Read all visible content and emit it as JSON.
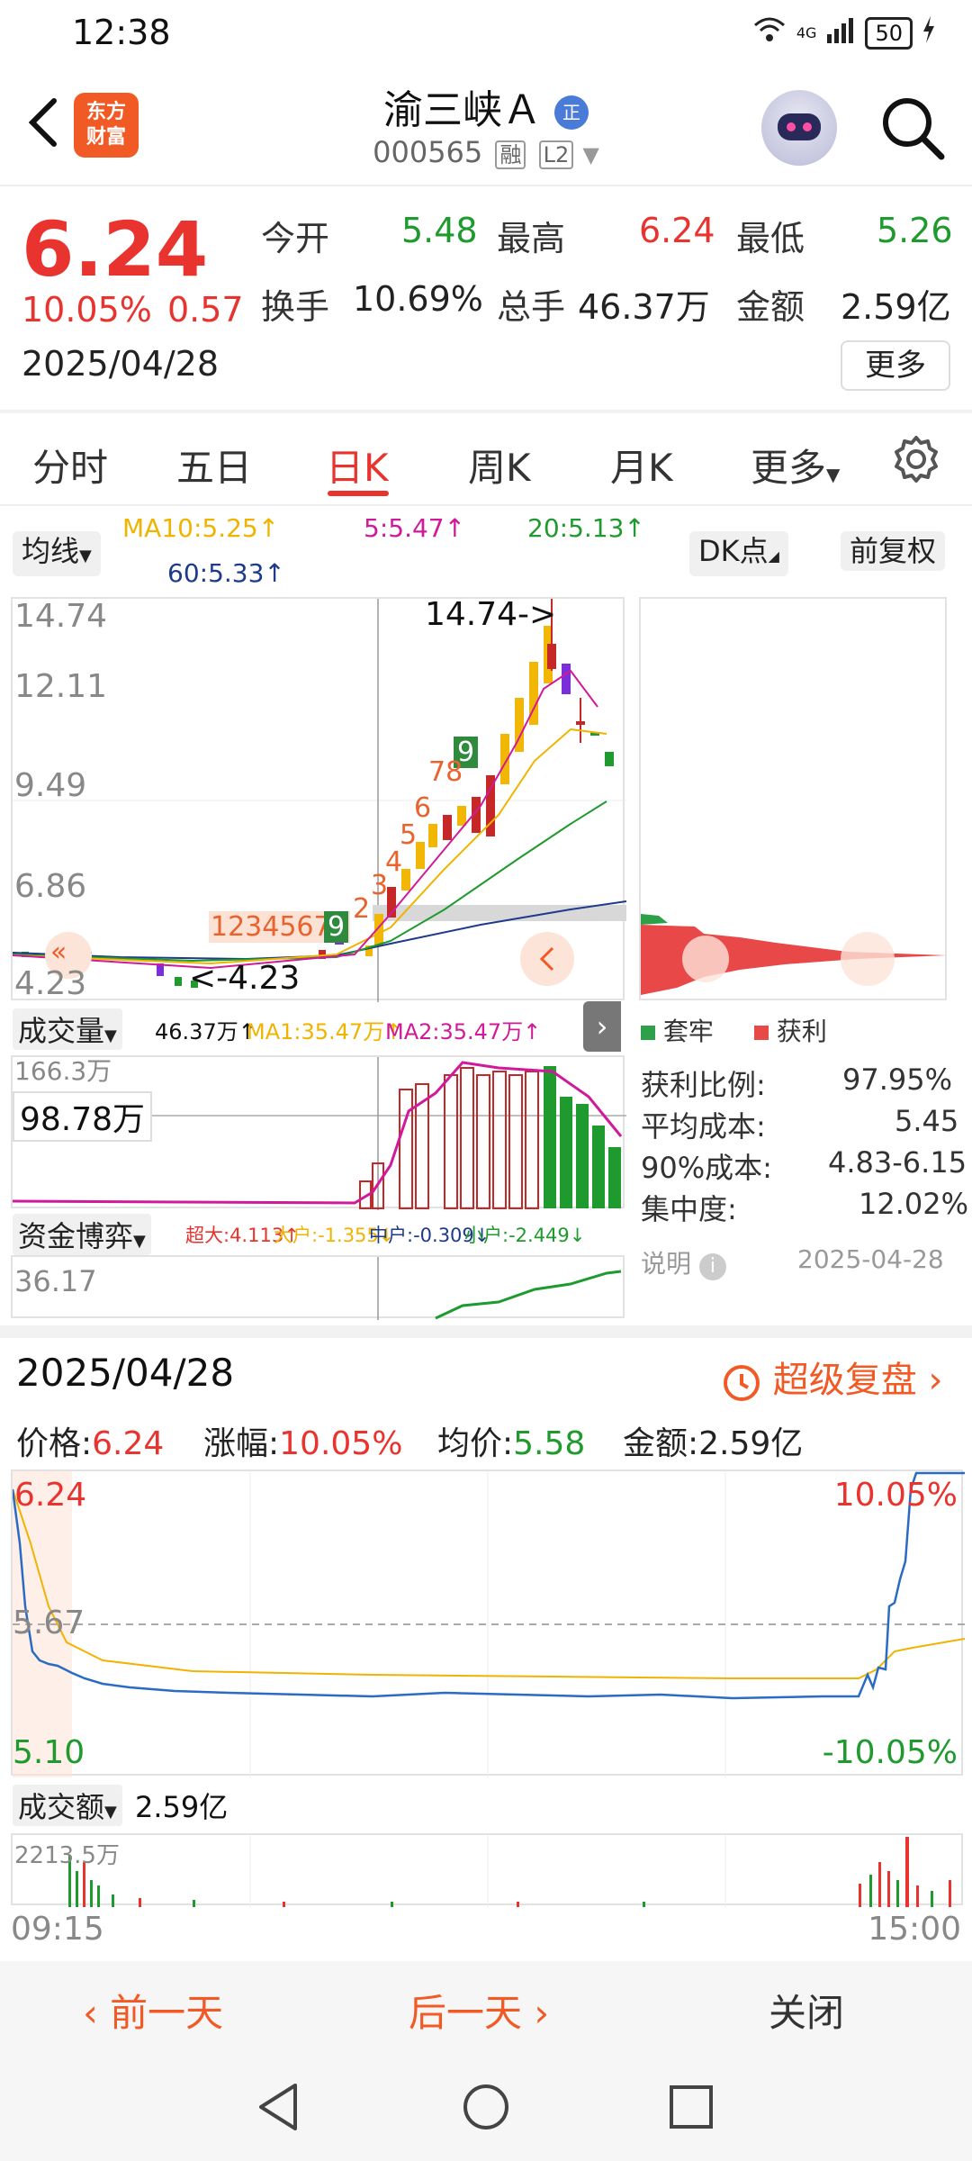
{
  "status": {
    "time": "12:38",
    "network": "4G",
    "battery": "50"
  },
  "header": {
    "logo_line1": "东方",
    "logo_line2": "财富",
    "stock_name": "渝三峡Ａ",
    "name_badge": "正",
    "stock_code": "000565",
    "tag_rong": "融",
    "tag_l2": "L2"
  },
  "quote": {
    "price": "6.24",
    "change_pct": "10.05%",
    "change_amt": "0.57",
    "date": "2025/04/28",
    "open_label": "今开",
    "open": "5.48",
    "high_label": "最高",
    "high": "6.24",
    "low_label": "最低",
    "low": "5.26",
    "turnover_label": "换手",
    "turnover": "10.69%",
    "volume_label": "总手",
    "volume": "46.37万",
    "amount_label": "金额",
    "amount": "2.59亿",
    "more": "更多"
  },
  "tabs": [
    "分时",
    "五日",
    "日K",
    "周K",
    "月K",
    "更多"
  ],
  "indicators": {
    "ma_button": "均线",
    "ma10": "MA10:5.25↑",
    "ma5": "5:5.47↑",
    "ma20": "20:5.13↑",
    "ma60": "60:5.33↑",
    "dk_button": "DK点",
    "fq_button": "前复权"
  },
  "kline": {
    "y_labels": [
      "14.74",
      "12.11",
      "9.49",
      "6.86",
      "4.23"
    ],
    "high_marker": "14.74->",
    "low_marker": "<-4.23",
    "nine_seq_1": "12345678",
    "nine_seq_2": "12345678",
    "nine_top": "9",
    "legend_trap": "套牢",
    "legend_profit": "获利"
  },
  "volume": {
    "button": "成交量",
    "value": "46.37万↑",
    "ma1": "MA1:35.47万↑",
    "ma2": "MA2:35.47万↑",
    "y_top": "166.3万",
    "cursor_value": "98.78万"
  },
  "fund": {
    "button": "资金博弈",
    "super_large": "超大:4.113↑",
    "large": "大户:-1.355↓",
    "mid": "中户:-0.309↓",
    "small": "小户:-2.449↓",
    "y_top": "36.17"
  },
  "chip": {
    "profit_ratio_label": "获利比例:",
    "profit_ratio": "97.95%",
    "avg_cost_label": "平均成本:",
    "avg_cost": "5.45",
    "cost90_label": "90%成本:",
    "cost90": "4.83-6.15",
    "concentration_label": "集中度:",
    "concentration": "12.02%",
    "note_label": "说明",
    "note_date": "2025-04-28"
  },
  "intraday": {
    "date": "2025/04/28",
    "replay": "超级复盘",
    "price_label": "价格:",
    "price": "6.24",
    "chg_label": "涨幅:",
    "chg": "10.05%",
    "avg_label": "均价:",
    "avg": "5.58",
    "amt_label": "金额:",
    "amt": "2.59亿",
    "y_high": "6.24",
    "y_mid": "5.67",
    "y_low": "5.10",
    "pct_high": "10.05%",
    "pct_low": "-10.05%",
    "amount_button": "成交额",
    "amount_value": "2.59亿",
    "amount_top": "2213.5万",
    "time_start": "09:15",
    "time_end": "15:00"
  },
  "bottom": {
    "prev": "前一天",
    "next": "后一天",
    "close": "关闭"
  },
  "colors": {
    "up": "#e8332e",
    "down": "#1f9a2e",
    "accent": "#f15a24"
  }
}
